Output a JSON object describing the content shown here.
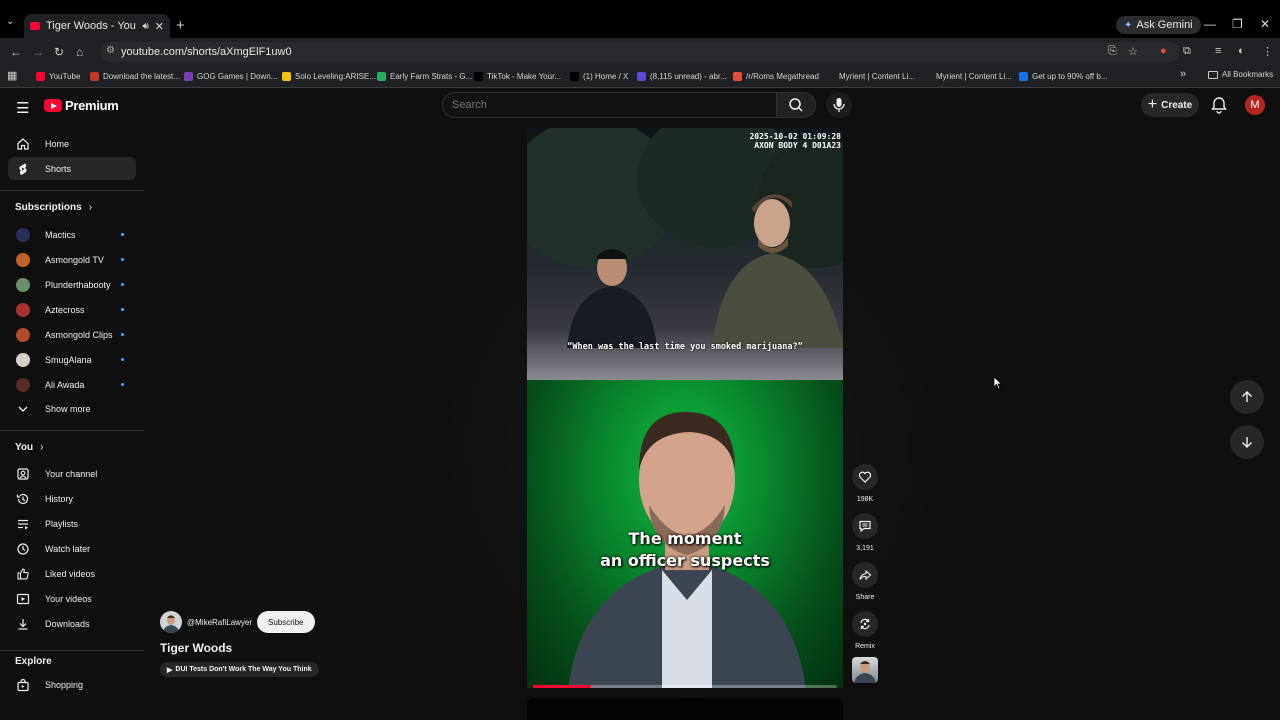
{
  "browser": {
    "tab_title": "Tiger Woods - YouTube",
    "url": "youtube.com/shorts/aXmgElF1uw0",
    "ask_gemini": "Ask Gemini",
    "bookmarks": [
      {
        "label": "YouTube",
        "color": "#ff0033"
      },
      {
        "label": "Download the latest...",
        "color": "#c0392b"
      },
      {
        "label": "GOG Games | Down...",
        "color": "#7b3fb5"
      },
      {
        "label": "Solo Leveling:ARISE...",
        "color": "#f1c40f"
      },
      {
        "label": "Early Farm Strats - G...",
        "color": "#27ae60"
      },
      {
        "label": "TikTok - Make Your...",
        "color": "#000000"
      },
      {
        "label": "(1) Home / X",
        "color": "#000000"
      },
      {
        "label": "(8,115 unread) - abr...",
        "color": "#5b4bd6"
      },
      {
        "label": "/r/Roms Megathread",
        "color": "#e74c3c"
      },
      {
        "label": "Myrient | Content Li...",
        "color": "#202124"
      },
      {
        "label": "Myrient | Content Li...",
        "color": "#202124"
      },
      {
        "label": "Get up to 90% off b...",
        "color": "#1a73e8"
      }
    ],
    "all_bookmarks": "All Bookmarks"
  },
  "header": {
    "logo_text": "Premium",
    "search_placeholder": "Search",
    "create_label": "Create",
    "avatar_letter": "M"
  },
  "sidebar": {
    "main": [
      {
        "label": "Home",
        "icon": "home-icon"
      },
      {
        "label": "Shorts",
        "icon": "shorts-icon",
        "active": true
      }
    ],
    "subscriptions_header": "Subscriptions",
    "subscriptions": [
      {
        "label": "Mactics",
        "color": "#2b2d5c"
      },
      {
        "label": "Asmongold TV",
        "color": "#c0622a"
      },
      {
        "label": "Plunderthabooty",
        "color": "#6a8f6a"
      },
      {
        "label": "Aztecross",
        "color": "#a83232"
      },
      {
        "label": "Asmongold Clips",
        "color": "#b34a2a"
      },
      {
        "label": "SmugAlana",
        "color": "#d8d0c8"
      },
      {
        "label": "Ali Awada",
        "color": "#5a2a2a"
      }
    ],
    "show_more": "Show more",
    "you_header": "You",
    "you_items": [
      {
        "label": "Your channel",
        "icon": "channel-icon"
      },
      {
        "label": "History",
        "icon": "history-icon"
      },
      {
        "label": "Playlists",
        "icon": "playlists-icon"
      },
      {
        "label": "Watch later",
        "icon": "watch-later-icon"
      },
      {
        "label": "Liked videos",
        "icon": "like-icon"
      },
      {
        "label": "Your videos",
        "icon": "your-videos-icon"
      },
      {
        "label": "Downloads",
        "icon": "download-icon"
      }
    ],
    "explore_header": "Explore",
    "explore_items": [
      {
        "label": "Shopping",
        "icon": "shopping-icon"
      }
    ]
  },
  "short": {
    "timestamp_line1": "2025-10-02 01:09:28",
    "timestamp_line2": "AXON BODY 4 D01A23",
    "bodycam_caption": "“When was the last time you smoked marijuana?”",
    "subtitle_line1": "The moment",
    "subtitle_line2": "an officer suspects",
    "progress": 0.19,
    "channel": "@MikeRafiLawyer",
    "subscribe_label": "Subscribe",
    "title": "Tiger Woods",
    "related_video": "DUI Tests Don't Work The Way You Think"
  },
  "actions": {
    "likes": "198K",
    "comments": "3,191",
    "share": "Share",
    "remix": "Remix"
  }
}
